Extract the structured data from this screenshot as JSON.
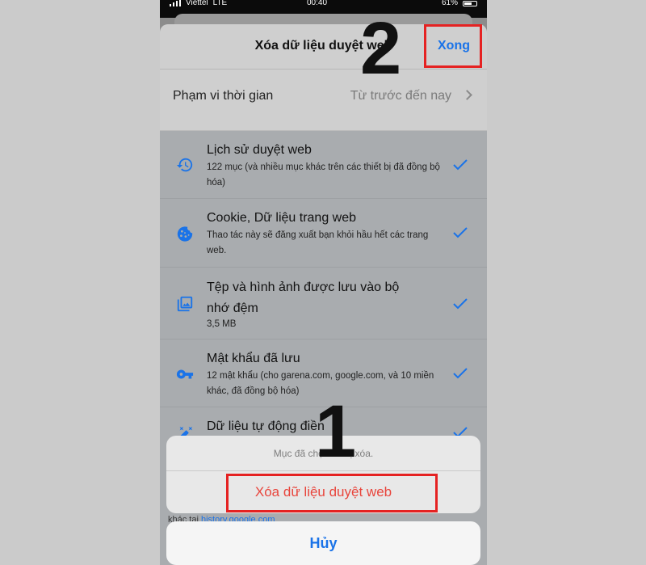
{
  "status_bar": {
    "carrier": "Viettel",
    "network": "LTE",
    "time": "00:40",
    "battery": "61%"
  },
  "nav": {
    "title": "Xóa dữ liệu duyệt web",
    "done_label": "Xong"
  },
  "time_range": {
    "label": "Phạm vi thời gian",
    "value": "Từ trước đến nay"
  },
  "items": [
    {
      "title": "Lịch sử duyệt web",
      "desc": "122 mục (và nhiều mục khác trên các thiết bị đã đồng bộ hóa)",
      "icon": "history-icon",
      "checked": true
    },
    {
      "title": "Cookie, Dữ liệu trang web",
      "desc": "Thao tác này sẽ đăng xuất bạn khỏi hầu hết các trang web.",
      "icon": "cookie-icon",
      "checked": true
    },
    {
      "title": "Tệp và hình ảnh được lưu vào bộ nhớ đệm",
      "desc": "3,5 MB",
      "icon": "image-icon",
      "checked": true
    },
    {
      "title": "Mật khẩu đã lưu",
      "desc": "12 mật khẩu (cho garena.com, google.com, và 10 miền khác, đã đồng bộ hóa)",
      "icon": "key-icon",
      "checked": true
    },
    {
      "title": "Dữ liệu tự động điền",
      "desc": "",
      "icon": "autofill-icon",
      "checked": true
    }
  ],
  "action_sheet": {
    "message": "Mục đã chọn sẽ bị xóa.",
    "confirm_label": "Xóa dữ liệu duyệt web",
    "cancel_label": "Hủy"
  },
  "footer": {
    "prefix": "khác tại",
    "link": "history.google.com"
  },
  "annotations": {
    "step_1": "1",
    "step_2": "2"
  },
  "colors": {
    "accent_blue": "#1a73e8",
    "destructive_red": "#e8453c",
    "highlight_red": "#e52222"
  }
}
